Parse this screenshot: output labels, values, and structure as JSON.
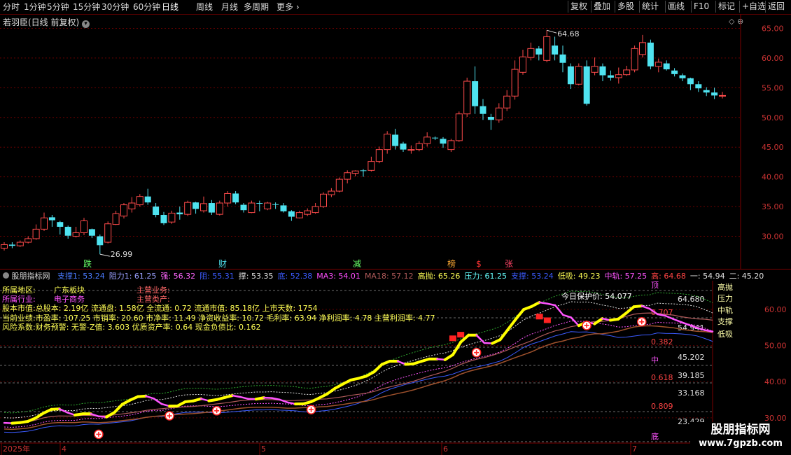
{
  "toolbar": {
    "periods": [
      "分时",
      "1分钟",
      "5分钟",
      "15分钟",
      "30分钟",
      "60分钟",
      "日线",
      "周线",
      "月线",
      "多周期",
      "更多"
    ],
    "active_period": "日线",
    "right_buttons": [
      "复权",
      "叠加",
      "多股",
      "统计",
      "画线",
      "F10",
      "标记",
      "+自选",
      "返回"
    ]
  },
  "main_chart": {
    "stock_title": "若羽臣(日线 前复权)",
    "y_ticks": [
      "65.00",
      "60.00",
      "55.00",
      "50.00",
      "45.00",
      "40.00",
      "35.00",
      "30.00"
    ],
    "high_label": "64.68",
    "low_label": "26.99",
    "markers": [
      "跌",
      "财",
      "减",
      "榜",
      "$",
      "张"
    ]
  },
  "sub_chart": {
    "indicator_name": "股朋指标网",
    "values": [
      {
        "text": "支撑1: 53.24",
        "color": "#4a7bff"
      },
      {
        "text": "阻力1: 61.25",
        "color": "#9aa0ff"
      },
      {
        "text": "强: 56.32",
        "color": "#ff66ff"
      },
      {
        "text": "阻: 55.31",
        "color": "#3b5bff"
      },
      {
        "text": "撑: 53.35",
        "color": "#e0e0e0"
      },
      {
        "text": "底: 52.38",
        "color": "#3b5bff"
      },
      {
        "text": "MA3: 54.01",
        "color": "#ff4fff"
      },
      {
        "text": "MA18: 57.12",
        "color": "#b05a5a"
      },
      {
        "text": "高抛: 65.26",
        "color": "#ffff55"
      },
      {
        "text": "压力: 61.25",
        "color": "#66ffff"
      },
      {
        "text": "支撑: 53.24",
        "color": "#3b5bff"
      },
      {
        "text": "低吸: 49.23",
        "color": "#ffff55"
      },
      {
        "text": "中轨: 57.25",
        "color": "#ff55ff"
      },
      {
        "text": "高: 64.68",
        "color": "#ff4444"
      },
      {
        "text": "一: 54.94",
        "color": "#e0e0e0"
      },
      {
        "text": "二: 45.20",
        "color": "#e0e0e0"
      }
    ],
    "y_ticks": [
      "60.00",
      "50.00",
      "40.00",
      "30.00"
    ],
    "info_lines": {
      "region_label": "所属地区:",
      "region_value": "广东板块",
      "business_label": "主营业务:",
      "industry_label": "所属行业:",
      "industry_value": "电子商务",
      "product_label": "主营类产:",
      "line3": "股本市值:总股本: 2.19亿 流通盘: 1.58亿 全流通: 0.72 流通市值: 85.18亿 上市天数: 1754",
      "line4": "当前业绩:市盈率: 107.25 市销率: 20.60 市净率: 11.49 净资收益率: 10.72 毛利率: 63.94 净利润率: 4.78 主营利润率: 4.77",
      "line5": "风险系数:财务预警: 无警-Z值: 3.603 优质资产率: 0.64 现金负债比: 0.162"
    },
    "right_labels": [
      "高抛",
      "压力",
      "中轨",
      "支撑",
      "低吸"
    ],
    "protect_price": "今日保护价: 54.077",
    "fib_levels": [
      {
        "ratio": "顶",
        "value": "64.680"
      },
      {
        "ratio": "0.707",
        "value": "54.941"
      },
      {
        "ratio": "0.382",
        "value": "45.202"
      },
      {
        "ratio": "中",
        "value": "39.185"
      },
      {
        "ratio": "0.618",
        "value": "33.168"
      },
      {
        "ratio": "0.809",
        "value": "23.429"
      },
      {
        "ratio": "底",
        "value": ""
      }
    ],
    "date_labels": [
      "2025年",
      "4",
      "5",
      "6",
      "7"
    ]
  },
  "watermark": {
    "title": "股朋指标网",
    "url": "www.7gpzb.com"
  },
  "chart_data": {
    "type": "candlestick",
    "ylim": [
      25,
      66
    ],
    "candles": [
      [
        28.0,
        28.6,
        27.6,
        29.0
      ],
      [
        28.6,
        28.4,
        28.0,
        29.0
      ],
      [
        28.4,
        29.0,
        28.2,
        29.3
      ],
      [
        29.0,
        29.6,
        28.8,
        30.0
      ],
      [
        29.6,
        31.2,
        29.4,
        32.0
      ],
      [
        31.2,
        33.1,
        30.9,
        34.0
      ],
      [
        33.2,
        32.7,
        31.6,
        33.6
      ],
      [
        32.4,
        31.6,
        30.3,
        32.6
      ],
      [
        31.6,
        30.1,
        29.6,
        31.8
      ],
      [
        30.0,
        30.6,
        29.8,
        31.6
      ],
      [
        30.6,
        32.6,
        30.2,
        33.1
      ],
      [
        31.2,
        30.1,
        29.7,
        31.3
      ],
      [
        30.0,
        28.5,
        26.99,
        30.3
      ],
      [
        29.0,
        32.1,
        28.8,
        32.5
      ],
      [
        32.0,
        33.8,
        31.9,
        34.3
      ],
      [
        33.4,
        35.3,
        33.0,
        35.6
      ],
      [
        34.6,
        35.6,
        34.0,
        36.6
      ],
      [
        35.3,
        36.7,
        35.0,
        37.1
      ],
      [
        36.7,
        35.7,
        35.3,
        38.0
      ],
      [
        35.0,
        33.6,
        33.2,
        35.6
      ],
      [
        33.6,
        32.2,
        31.9,
        34.1
      ],
      [
        32.4,
        33.9,
        32.1,
        34.3
      ],
      [
        34.0,
        33.7,
        32.8,
        35.0
      ],
      [
        33.7,
        35.7,
        33.4,
        36.0
      ],
      [
        35.7,
        34.6,
        33.8,
        35.8
      ],
      [
        34.3,
        35.5,
        34.0,
        36.7
      ],
      [
        35.6,
        34.0,
        33.6,
        36.1
      ],
      [
        33.7,
        35.6,
        33.5,
        36.0
      ],
      [
        35.6,
        37.2,
        35.0,
        37.6
      ],
      [
        37.2,
        35.7,
        35.4,
        37.6
      ],
      [
        35.3,
        34.4,
        34.0,
        35.6
      ],
      [
        34.0,
        35.6,
        33.9,
        36.0
      ],
      [
        35.6,
        35.5,
        34.2,
        36.0
      ],
      [
        34.6,
        35.6,
        34.4,
        35.8
      ],
      [
        35.4,
        35.3,
        34.6,
        35.7
      ],
      [
        35.2,
        34.2,
        34.0,
        35.6
      ],
      [
        34.2,
        33.3,
        32.6,
        34.4
      ],
      [
        33.1,
        34.0,
        33.0,
        34.3
      ],
      [
        33.7,
        34.3,
        33.4,
        34.7
      ],
      [
        34.0,
        35.0,
        33.8,
        35.6
      ],
      [
        35.0,
        37.1,
        34.8,
        37.4
      ],
      [
        37.0,
        37.6,
        36.6,
        38.1
      ],
      [
        37.6,
        39.6,
        37.4,
        39.9
      ],
      [
        39.6,
        40.7,
        38.9,
        41.1
      ],
      [
        40.6,
        41.0,
        40.1,
        41.1
      ],
      [
        41.1,
        41.0,
        40.0,
        41.3
      ],
      [
        41.1,
        42.6,
        40.9,
        43.4
      ],
      [
        42.6,
        44.6,
        42.3,
        45.1
      ],
      [
        44.6,
        47.2,
        43.9,
        47.7
      ],
      [
        47.1,
        45.2,
        44.6,
        48.1
      ],
      [
        45.6,
        44.6,
        44.2,
        45.9
      ],
      [
        44.6,
        44.6,
        43.9,
        45.3
      ],
      [
        44.6,
        45.6,
        44.3,
        46.0
      ],
      [
        45.6,
        46.7,
        45.1,
        47.5
      ],
      [
        46.6,
        46.5,
        46.2,
        46.8
      ],
      [
        46.4,
        45.6,
        44.9,
        46.7
      ],
      [
        44.6,
        46.1,
        44.2,
        46.4
      ],
      [
        46.1,
        50.6,
        45.9,
        51.0
      ],
      [
        50.6,
        56.1,
        50.1,
        56.7
      ],
      [
        56.1,
        51.9,
        50.6,
        58.6
      ],
      [
        51.9,
        50.6,
        49.6,
        53.1
      ],
      [
        50.1,
        49.6,
        47.9,
        50.6
      ],
      [
        49.6,
        51.6,
        49.1,
        52.4
      ],
      [
        51.6,
        53.6,
        51.1,
        54.6
      ],
      [
        53.6,
        58.1,
        53.0,
        59.6
      ],
      [
        57.6,
        60.2,
        57.2,
        61.4
      ],
      [
        60.1,
        61.6,
        59.6,
        62.6
      ],
      [
        61.6,
        60.6,
        59.6,
        62.0
      ],
      [
        59.6,
        63.6,
        59.3,
        64.68
      ],
      [
        62.1,
        60.6,
        59.6,
        63.6
      ],
      [
        60.6,
        59.2,
        57.6,
        62.1
      ],
      [
        58.6,
        55.6,
        54.8,
        59.1
      ],
      [
        55.6,
        58.6,
        55.4,
        59.1
      ],
      [
        58.6,
        52.3,
        52.0,
        59.6
      ],
      [
        57.6,
        58.6,
        57.1,
        60.1
      ],
      [
        58.6,
        57.1,
        56.1,
        59.1
      ],
      [
        57.1,
        56.7,
        56.2,
        57.9
      ],
      [
        56.7,
        57.2,
        55.7,
        58.4
      ],
      [
        57.2,
        58.0,
        57.0,
        58.7
      ],
      [
        58.0,
        61.6,
        57.6,
        62.1
      ],
      [
        60.6,
        62.6,
        60.1,
        63.9
      ],
      [
        62.6,
        58.6,
        58.1,
        63.1
      ],
      [
        58.6,
        59.3,
        57.6,
        59.9
      ],
      [
        59.1,
        58.1,
        57.9,
        59.6
      ],
      [
        57.9,
        57.3,
        56.9,
        58.3
      ],
      [
        57.1,
        56.6,
        56.1,
        57.4
      ],
      [
        56.6,
        55.6,
        54.6,
        56.7
      ],
      [
        55.6,
        54.9,
        54.3,
        56.1
      ],
      [
        54.6,
        54.2,
        53.6,
        55.1
      ],
      [
        54.2,
        53.7,
        53.1,
        55.0
      ],
      [
        53.6,
        53.7,
        53.2,
        54.3
      ]
    ]
  }
}
